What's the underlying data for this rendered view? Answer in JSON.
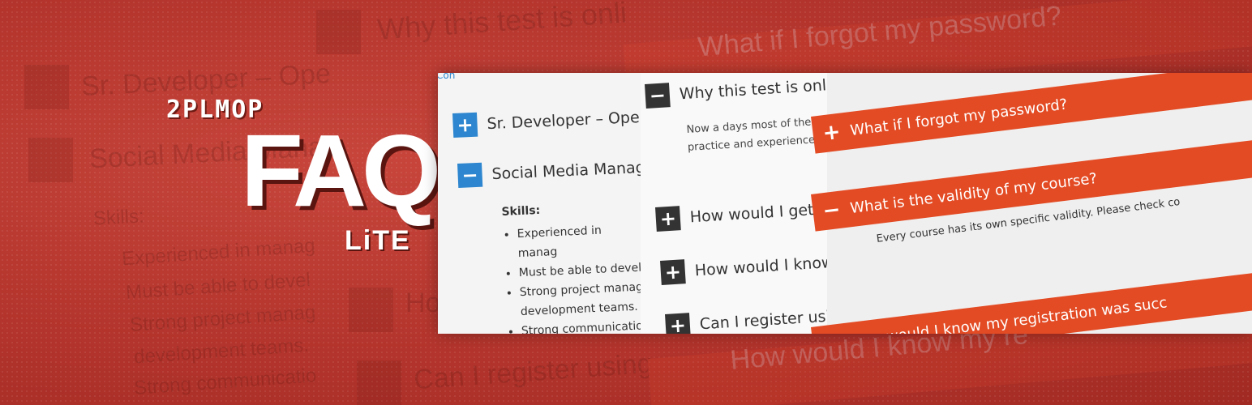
{
  "logo": {
    "brand": "2PLMOP",
    "product": "FAQ",
    "edition": "LiTE"
  },
  "colors": {
    "background": "#b3342c",
    "accent_orange": "#e34b24",
    "accent_blue": "#2d86cf",
    "icon_dark": "#333333"
  },
  "panel_left": {
    "items": [
      {
        "icon": "plus-icon",
        "title": "Sr. Developer – Ope"
      },
      {
        "icon": "minus-icon",
        "title": "Social Media Manag"
      }
    ],
    "skills_label": "Skills:",
    "skills": [
      "Experienced in manag",
      "Must be able to devel",
      "Strong project manag",
      "development teams.",
      "Strong communicatio"
    ],
    "peek": "Con"
  },
  "panel_middle": {
    "items": [
      {
        "icon": "minus-icon",
        "title": "Why this test is onli"
      },
      {
        "icon": "plus-icon",
        "title": "How would I get my"
      },
      {
        "icon": "plus-icon",
        "title": "How would I know"
      },
      {
        "icon": "plus-icon",
        "title": "Can I register using"
      }
    ],
    "answer_lines": [
      "Now a days most of the",
      "practice and experience"
    ]
  },
  "panel_right": {
    "items": [
      {
        "icon": "plus-icon",
        "title": "What if I forgot my password?"
      },
      {
        "icon": "minus-icon",
        "title": "What is the validity of my course?"
      },
      {
        "icon": "plus-icon",
        "title": "How would I know my registration was succ"
      }
    ],
    "answer": "Every course has its own specific validity. Please check co"
  },
  "background_echo": {
    "left_items": [
      "Sr. Developer – Ope",
      "Social Media Mana"
    ],
    "left_skills_label": "Skills:",
    "left_skills": [
      "Experienced in manag",
      "Must be able to devel",
      "Strong project manag",
      "development teams.",
      "Strong communicatio"
    ],
    "middle_items": [
      "Why this test is onli",
      "How",
      "Can I register using"
    ],
    "right_items": [
      "What if I forgot my password?",
      "How would I know my re"
    ]
  }
}
